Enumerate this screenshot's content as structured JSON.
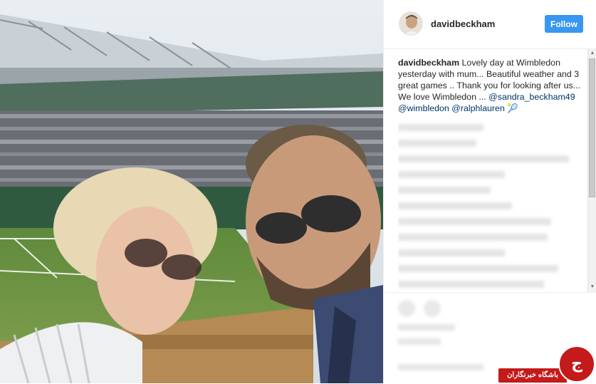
{
  "header": {
    "username": "davidbeckham",
    "follow_label": "Follow"
  },
  "caption": {
    "user": "davidbeckham",
    "text": " Lovely day at Wimbledon yesterday with mum... Beautiful weather and 3 great games .. Thank you for looking after us... We love Wimbledon ... ",
    "mention_1": "@sandra_beckham49",
    "mention_2": "@wimbledon",
    "mention_3": "@ralphlauren",
    "emoji": "🎾"
  },
  "watermark": {
    "text": "باشگاه خبرنگاران",
    "logo_glyph": "ج"
  },
  "colors": {
    "follow_bg": "#3897f0",
    "mention": "#003569",
    "watermark": "#c41a1a"
  }
}
